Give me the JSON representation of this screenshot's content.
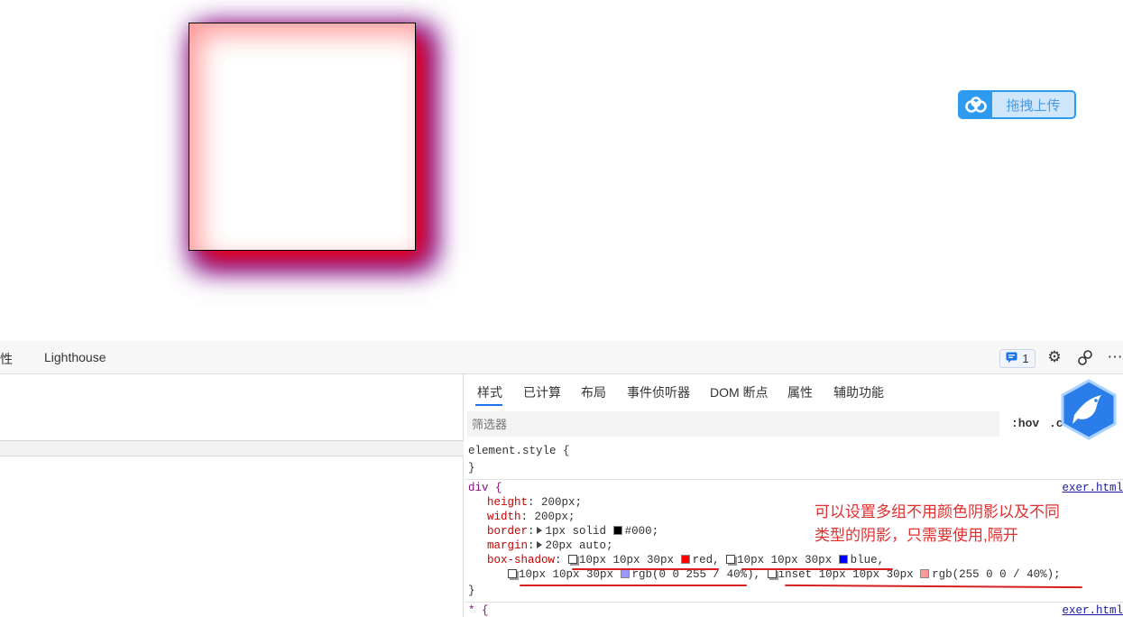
{
  "preview": {
    "upload_button_label": "拖拽上传"
  },
  "toolbar": {
    "partial_tab_label": "性",
    "lighthouse_tab": "Lighthouse",
    "issues_count": "1"
  },
  "styles_tabs": [
    "样式",
    "已计算",
    "布局",
    "事件侦听器",
    "DOM 断点",
    "属性",
    "辅助功能"
  ],
  "filter": {
    "placeholder": "筛选器",
    "hov": ":hov",
    "cls": ".c"
  },
  "element_style": {
    "selector": "element.style {",
    "close": "}"
  },
  "div_rule": {
    "selector": "div {",
    "source": "exer.html",
    "close": "}",
    "height_name": "height",
    "height_value": "200px;",
    "width_name": "width",
    "width_value": "200px;",
    "border_name": "border",
    "border_value_a": "1px solid",
    "border_value_b": "#000;",
    "margin_name": "margin",
    "margin_value": "20px auto;",
    "box_shadow_name": "box-shadow",
    "shadow1": "10px 10px 30px",
    "color1": "red",
    "shadow2": "10px 10px 30px",
    "color2": "blue",
    "shadow3": "10px 10px 30px",
    "color3": "rgb(0 0 255 / 40%)",
    "shadow4": "inset 10px 10px 30px",
    "color4": "rgb(255 0 0 / 40%);"
  },
  "next_rule": {
    "selector": "* {",
    "source": "exer.html"
  },
  "annotation": {
    "line1": "可以设置多组不用颜色阴影以及不同",
    "line2": "类型的阴影，只需要使用,隔开"
  },
  "colors": {
    "accent": "#1a73e8",
    "annotation": "#e03030",
    "upload_blue": "#2f9bf0"
  },
  "icons": [
    "baidu-cloud-icon",
    "issues-icon",
    "gear-icon",
    "connect-icon",
    "more-icon",
    "mascot-bird-icon"
  ]
}
